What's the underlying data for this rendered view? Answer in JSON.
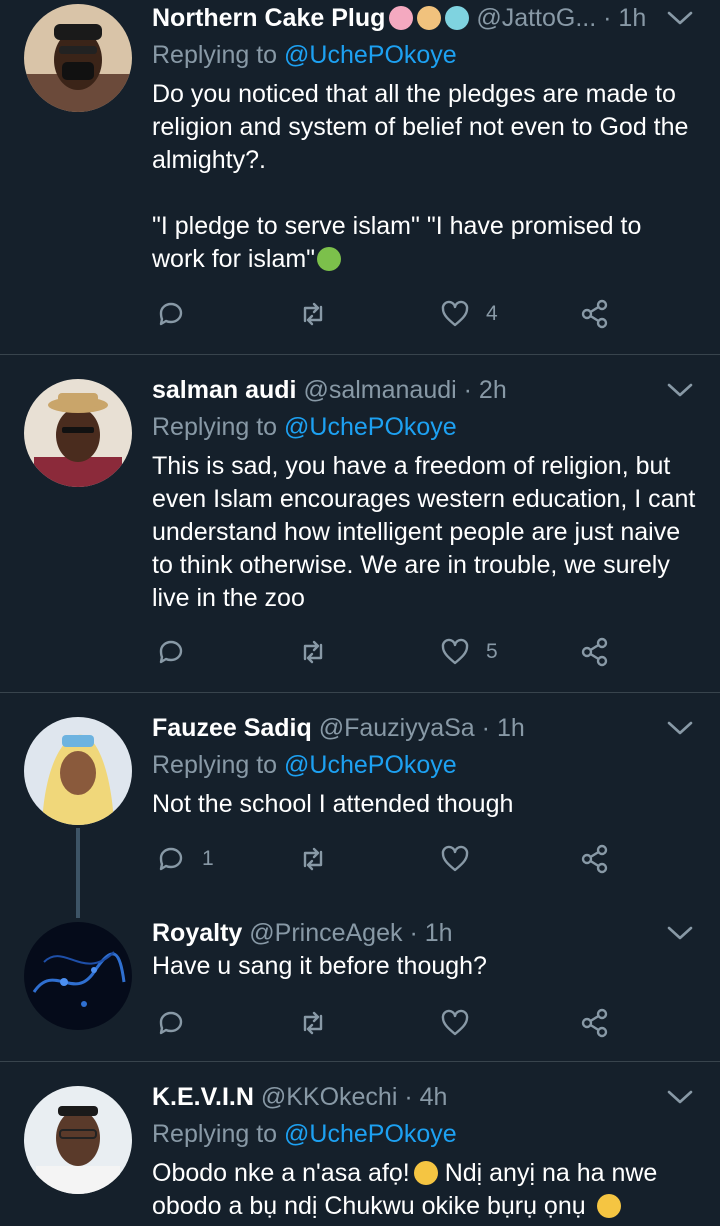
{
  "tweets": [
    {
      "name": "Northern Cake Plug",
      "handle": "@JattoG...",
      "time": "· 1h",
      "reply_label": "Replying to",
      "reply_to": "@UchePOkoye",
      "text": "Do you noticed that all the pledges are made to religion and system of belief not even to God the almighty?.\n\n\"I pledge to serve islam\" \"I have promised to work for islam\"",
      "emojis": [
        "birthday-cake-emoji",
        "cake-slice-emoji",
        "cupcake-emoji"
      ],
      "text_emoji": "nauseated-face-emoji",
      "reply_count": "",
      "retweet_count": "",
      "like_count": "4"
    },
    {
      "name": "salman audi",
      "handle": "@salmanaudi",
      "time": "· 2h",
      "reply_label": "Replying to",
      "reply_to": "@UchePOkoye",
      "text": "This is sad, you have a freedom of religion, but even Islam encourages western education, I cant understand how intelligent people are just naive to think otherwise. We are in trouble, we surely live in the zoo",
      "reply_count": "",
      "retweet_count": "",
      "like_count": "5"
    },
    {
      "name": "Fauzee Sadiq",
      "handle": "@FauziyyaSa",
      "time": "· 1h",
      "reply_label": "Replying to",
      "reply_to": "@UchePOkoye",
      "text": "Not the school I attended though",
      "reply_count": "1",
      "retweet_count": "",
      "like_count": ""
    },
    {
      "name": "Royalty",
      "handle": "@PrinceAgek",
      "time": "· 1h",
      "text": "Have u sang it before though?",
      "reply_count": "",
      "retweet_count": "",
      "like_count": ""
    },
    {
      "name": "K.E.V.I.N",
      "handle": "@KKOkechi",
      "time": "· 4h",
      "reply_label": "Replying to",
      "reply_to": "@UchePOkoye",
      "text_part1": "Obodo nke a n'asa afọ!",
      "text_part2": " Ndị anyị na ha nwe obodo a bụ ndị Chukwu okike bụrụ ọnụ ",
      "text_emojis": [
        "eye-roll-emoji",
        "sleepy-face-emoji"
      ]
    }
  ],
  "colors": {
    "background": "#15202b",
    "divider": "#38444d",
    "secondary_text": "#8899a6",
    "link": "#1da1f2"
  },
  "icons": [
    "reply-icon",
    "retweet-icon",
    "like-icon",
    "share-icon",
    "chevron-down-icon"
  ]
}
